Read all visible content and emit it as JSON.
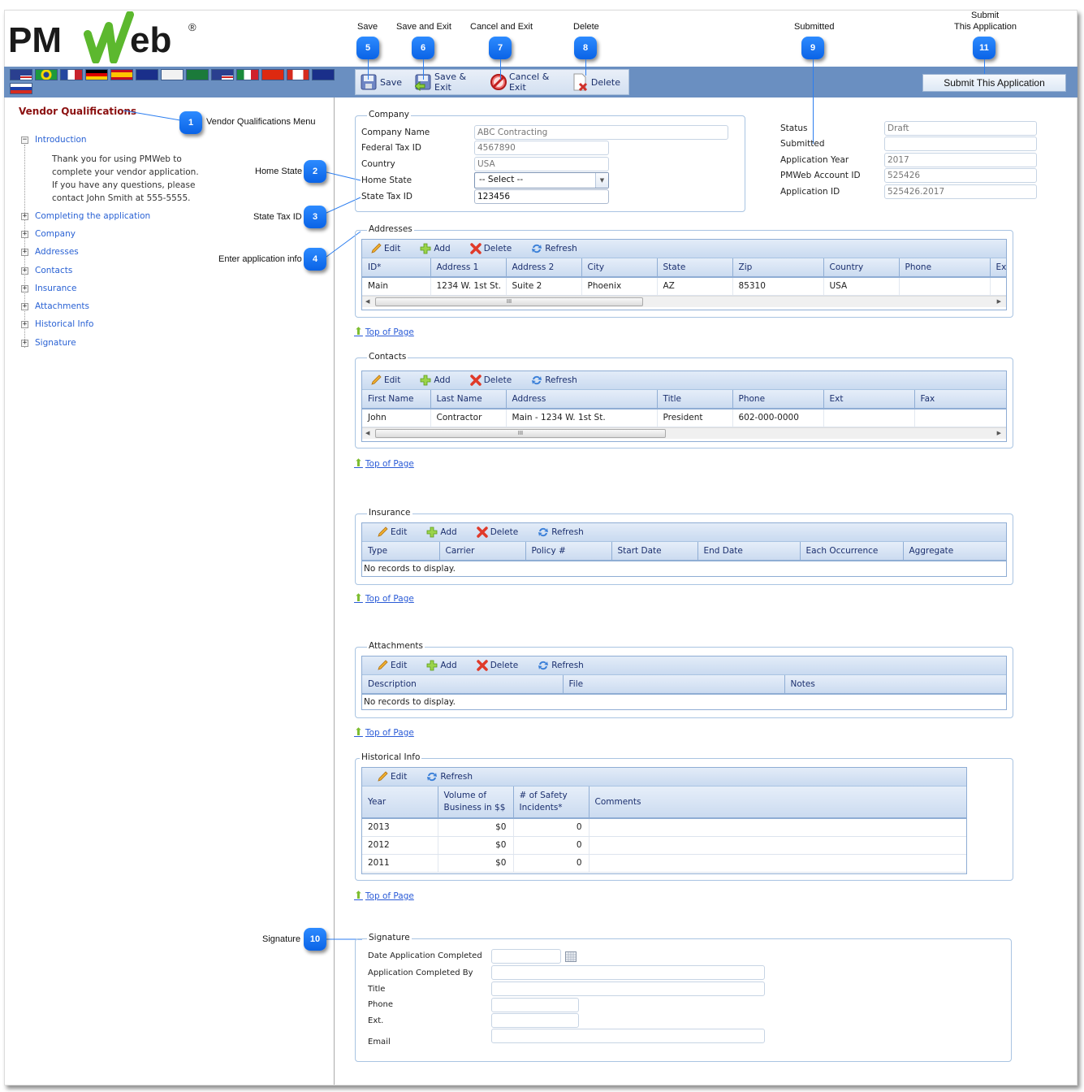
{
  "app": {
    "logo_text": "PMWeb",
    "logo_mark": "®"
  },
  "colors": {
    "callout": "#1575f5",
    "toolbar_bar": "#6a8fc1",
    "accent_link": "#2a62d4",
    "menu_title": "#8b1010"
  },
  "flags": [
    {
      "name": "us-flag"
    },
    {
      "name": "brazil-flag"
    },
    {
      "name": "france-flag"
    },
    {
      "name": "germany-flag"
    },
    {
      "name": "spain-flag"
    },
    {
      "name": "australia-flag"
    },
    {
      "name": "hill-international-flag"
    },
    {
      "name": "saudi-arabia-flag"
    },
    {
      "name": "us-flag-2"
    },
    {
      "name": "mexico-flag"
    },
    {
      "name": "china-flag"
    },
    {
      "name": "canada-flag"
    },
    {
      "name": "new-zealand-flag"
    },
    {
      "name": "russia-flag"
    }
  ],
  "toolbar": {
    "save": "Save",
    "save_exit": "Save & Exit",
    "cancel_exit": "Cancel & Exit",
    "delete": "Delete",
    "submit": "Submit This Application"
  },
  "callouts": [
    {
      "num": "1",
      "label": "Vendor Qualifications Menu"
    },
    {
      "num": "2",
      "label": "Home State"
    },
    {
      "num": "3",
      "label": "State Tax ID"
    },
    {
      "num": "4",
      "label": "Enter application info"
    },
    {
      "num": "5",
      "label": "Save"
    },
    {
      "num": "6",
      "label": "Save and Exit"
    },
    {
      "num": "7",
      "label": "Cancel and Exit"
    },
    {
      "num": "8",
      "label": "Delete"
    },
    {
      "num": "9",
      "label": "Submitted"
    },
    {
      "num": "10",
      "label": "Signature"
    },
    {
      "num": "11",
      "label_line1": "Submit",
      "label_line2": "This Application"
    }
  ],
  "sidebar": {
    "title": "Vendor Qualifications",
    "intro": {
      "label": "Introduction",
      "text": "Thank you for using PMWeb to complete your vendor application. If you have any questions, please contact John Smith at 555-5555."
    },
    "items": [
      "Completing the application",
      "Company",
      "Addresses",
      "Contacts",
      "Insurance",
      "Attachments",
      "Historical Info",
      "Signature"
    ]
  },
  "company": {
    "legend": "Company",
    "fields": [
      {
        "label": "Company Name",
        "value": "ABC Contracting"
      },
      {
        "label": "Federal Tax ID",
        "value": "4567890"
      },
      {
        "label": "Country",
        "value": "USA"
      },
      {
        "label": "Home State",
        "value": "-- Select --"
      },
      {
        "label": "State Tax ID",
        "value": "123456"
      }
    ]
  },
  "status_panel": {
    "fields": [
      {
        "label": "Status",
        "value": "Draft"
      },
      {
        "label": "Submitted",
        "value": ""
      },
      {
        "label": "Application Year",
        "value": "2017"
      },
      {
        "label": "PMWeb Account ID",
        "value": "525426"
      },
      {
        "label": "Application ID",
        "value": "525426.2017"
      }
    ]
  },
  "grid_buttons": {
    "edit": "Edit",
    "add": "Add",
    "delete": "Delete",
    "refresh": "Refresh"
  },
  "top_of_page": "Top of Page",
  "no_records": "No records to display.",
  "addresses": {
    "legend": "Addresses",
    "columns": [
      "ID*",
      "Address 1",
      "Address 2",
      "City",
      "State",
      "Zip",
      "Country",
      "Phone",
      "Ext"
    ],
    "rows": [
      [
        "Main",
        "1234 W. 1st St.",
        "Suite 2",
        "Phoenix",
        "AZ",
        "85310",
        "USA",
        "",
        ""
      ]
    ]
  },
  "contacts": {
    "legend": "Contacts",
    "columns": [
      "First Name",
      "Last Name",
      "Address",
      "Title",
      "Phone",
      "Ext",
      "Fax"
    ],
    "rows": [
      [
        "John",
        "Contractor",
        "Main - 1234 W. 1st St.",
        "President",
        "602-000-0000",
        "",
        ""
      ]
    ]
  },
  "insurance": {
    "legend": "Insurance",
    "columns": [
      "Type",
      "Carrier",
      "Policy #",
      "Start Date",
      "End Date",
      "Each Occurrence",
      "Aggregate"
    ],
    "rows": []
  },
  "attachments": {
    "legend": "Attachments",
    "columns": [
      "Description",
      "File",
      "Notes"
    ],
    "rows": []
  },
  "historical": {
    "legend": "Historical Info",
    "columns": [
      "Year",
      "Volume of Business in $$",
      "# of Safety Incidents*",
      "Comments"
    ],
    "col_lines": [
      [
        "Year"
      ],
      [
        "Volume of",
        "Business in $$"
      ],
      [
        "# of Safety",
        "Incidents*"
      ],
      [
        "Comments"
      ]
    ],
    "rows": [
      [
        "2013",
        "$0",
        "0",
        ""
      ],
      [
        "2012",
        "$0",
        "0",
        ""
      ],
      [
        "2011",
        "$0",
        "0",
        ""
      ]
    ]
  },
  "signature": {
    "legend": "Signature",
    "fields": [
      {
        "label": "Date Application Completed",
        "value": ""
      },
      {
        "label": "Application Completed By",
        "value": ""
      },
      {
        "label": "Title",
        "value": ""
      },
      {
        "label": "Phone",
        "value": ""
      },
      {
        "label": "Ext.",
        "value": ""
      },
      {
        "label": "Email",
        "value": ""
      }
    ]
  }
}
